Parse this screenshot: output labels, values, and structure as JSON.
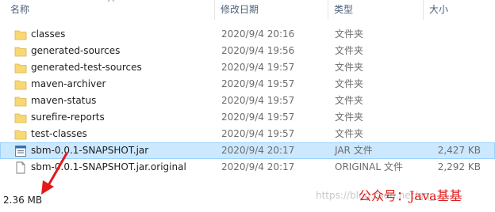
{
  "columns": {
    "name": "名称",
    "date": "修改日期",
    "type": "类型",
    "size": "大小"
  },
  "files": [
    {
      "name": "classes",
      "date": "2020/9/4 20:16",
      "type": "文件夹",
      "size": "",
      "icon": "folder-icon"
    },
    {
      "name": "generated-sources",
      "date": "2020/9/4 19:56",
      "type": "文件夹",
      "size": "",
      "icon": "folder-icon"
    },
    {
      "name": "generated-test-sources",
      "date": "2020/9/4 19:57",
      "type": "文件夹",
      "size": "",
      "icon": "folder-icon"
    },
    {
      "name": "maven-archiver",
      "date": "2020/9/4 19:57",
      "type": "文件夹",
      "size": "",
      "icon": "folder-icon"
    },
    {
      "name": "maven-status",
      "date": "2020/9/4 19:57",
      "type": "文件夹",
      "size": "",
      "icon": "folder-icon"
    },
    {
      "name": "surefire-reports",
      "date": "2020/9/4 19:57",
      "type": "文件夹",
      "size": "",
      "icon": "folder-icon"
    },
    {
      "name": "test-classes",
      "date": "2020/9/4 19:57",
      "type": "文件夹",
      "size": "",
      "icon": "folder-icon"
    },
    {
      "name": "sbm-0.0.1-SNAPSHOT.jar",
      "date": "2020/9/4 20:17",
      "type": "JAR 文件",
      "size": "2,427 KB",
      "icon": "jar-file-icon",
      "selected": true
    },
    {
      "name": "sbm-0.0.1-SNAPSHOT.jar.original",
      "date": "2020/9/4 20:17",
      "type": "ORIGINAL 文件",
      "size": "2,292 KB",
      "icon": "document-icon"
    }
  ],
  "status": {
    "selected_size": "2.36 MB"
  },
  "overlay": {
    "watermark": "https://blog.csdn.net/qq_",
    "wechat": "公众号：Java基基"
  },
  "colors": {
    "folder": "#f8d775",
    "selection": "#cce8ff",
    "selection_border": "#99d1ff",
    "annotation": "#e11b1b"
  }
}
